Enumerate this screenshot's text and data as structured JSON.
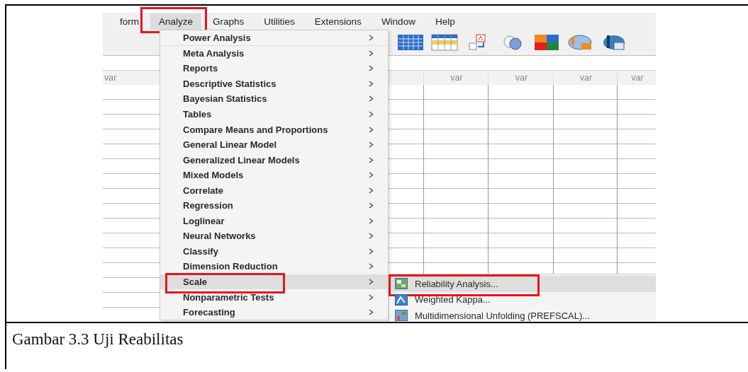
{
  "menubar": [
    {
      "label": "form",
      "selected": false
    },
    {
      "label": "Analyze",
      "selected": true
    },
    {
      "label": "Graphs",
      "selected": false
    },
    {
      "label": "Utilities",
      "selected": false
    },
    {
      "label": "Extensions",
      "selected": false
    },
    {
      "label": "Window",
      "selected": false
    },
    {
      "label": "Help",
      "selected": false
    }
  ],
  "grid": {
    "columns": [
      "var",
      "var",
      "var",
      "var",
      "var"
    ]
  },
  "menu": {
    "items": [
      {
        "label": "Power Analysis",
        "selected": false
      },
      {
        "label": "Meta Analysis",
        "selected": false
      },
      {
        "label": "Reports",
        "selected": false
      },
      {
        "label": "Descriptive Statistics",
        "selected": false
      },
      {
        "label": "Bayesian Statistics",
        "selected": false
      },
      {
        "label": "Tables",
        "selected": false
      },
      {
        "label": "Compare Means and Proportions",
        "selected": false
      },
      {
        "label": "General Linear Model",
        "selected": false
      },
      {
        "label": "Generalized Linear Models",
        "selected": false
      },
      {
        "label": "Mixed Models",
        "selected": false
      },
      {
        "label": "Correlate",
        "selected": false
      },
      {
        "label": "Regression",
        "selected": false
      },
      {
        "label": "Loglinear",
        "selected": false
      },
      {
        "label": "Neural Networks",
        "selected": false
      },
      {
        "label": "Classify",
        "selected": false
      },
      {
        "label": "Dimension Reduction",
        "selected": false
      },
      {
        "label": "Scale",
        "selected": true
      },
      {
        "label": "Nonparametric Tests",
        "selected": false
      },
      {
        "label": "Forecasting",
        "selected": false
      }
    ]
  },
  "submenu": {
    "items": [
      {
        "label": "Reliability Analysis...",
        "selected": true,
        "kind": "reliability"
      },
      {
        "label": "Weighted Kappa...",
        "selected": false,
        "kind": "kappa"
      },
      {
        "label": "Multidimensional Unfolding (PREFSCAL)...",
        "selected": false,
        "kind": "unfolding"
      }
    ]
  },
  "caption": "Gambar 3.3 Uji Reabilitas"
}
